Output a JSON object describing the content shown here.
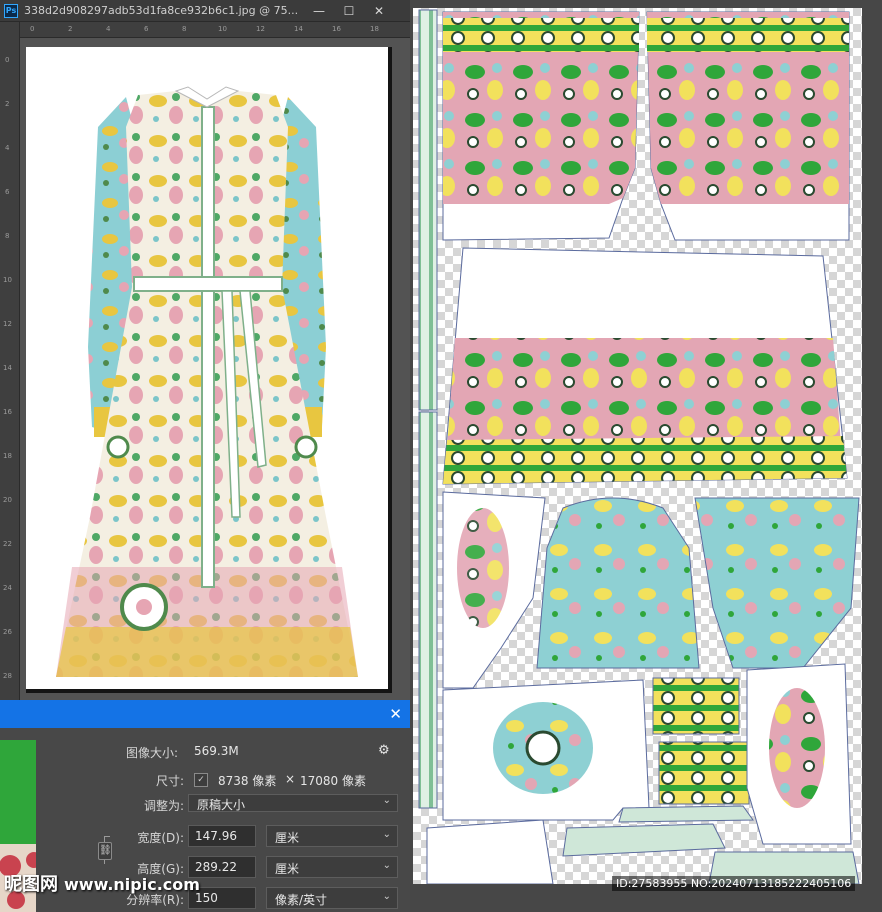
{
  "window": {
    "app_icon_label": "Ps",
    "title": "338d2d908297adb53d1fa8ce932b6c1.jpg @ 75...",
    "buttons": {
      "minimize": "—",
      "maximize": "☐",
      "close": "✕"
    }
  },
  "rulers": {
    "top": [
      "0",
      "2",
      "4",
      "6",
      "8",
      "10",
      "12",
      "14",
      "16",
      "18"
    ],
    "left": [
      "0",
      "2",
      "4",
      "6",
      "8",
      "10",
      "12",
      "14",
      "16",
      "18",
      "20",
      "22",
      "24",
      "26",
      "28"
    ]
  },
  "dialog": {
    "close_label": "✕",
    "image_size_label": "图像大小:",
    "image_size_value": "569.3M",
    "gear_label": "⚙",
    "dimensions_label": "尺寸:",
    "dimensions_check": "✓",
    "dimensions_width": "8738 像素",
    "dimensions_x": "×",
    "dimensions_height": "17080 像素",
    "fit_to_label": "调整为:",
    "fit_to_value": "原稿大小",
    "width_label": "宽度(D):",
    "width_value": "147.96",
    "width_unit": "厘米",
    "height_label": "高度(G):",
    "height_value": "289.22",
    "height_unit": "厘米",
    "resolution_label": "分辨率(R):",
    "resolution_value": "150",
    "resolution_unit": "像素/英寸",
    "chevron": "⌄"
  },
  "watermark": {
    "logo_text": "昵图网",
    "site": "www.nipic.com"
  },
  "sheet": {
    "id_text": "ID:27583955 NO:20240713185222405106"
  },
  "colors": {
    "accent_blue": "#1473e6",
    "pattern_pink": "#e3a6b4",
    "pattern_green": "#2fa63a",
    "pattern_yellow": "#f2e15c",
    "pattern_turquoise": "#8ed0d3"
  }
}
